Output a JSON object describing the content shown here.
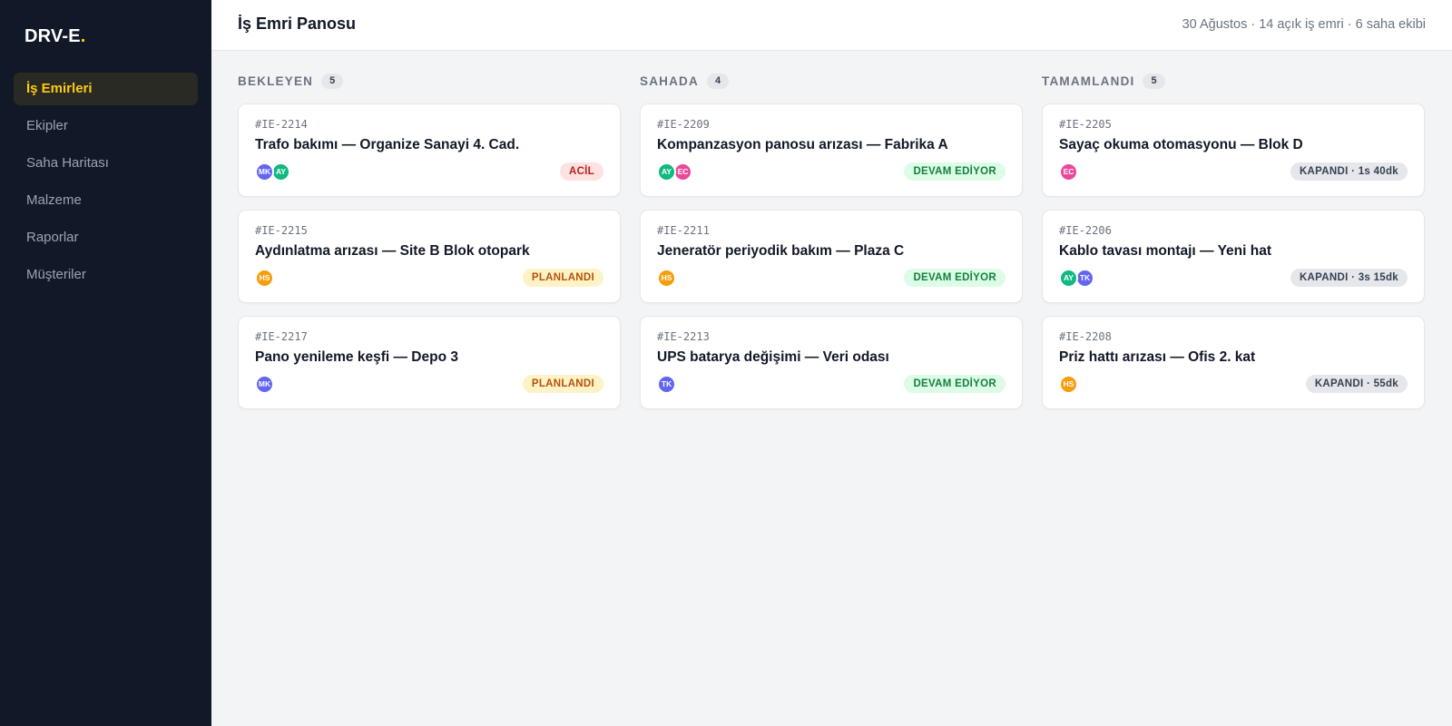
{
  "app": {
    "logo_text": "DRV-E",
    "logo_dot": "."
  },
  "sidebar": {
    "items": [
      {
        "label": "İş Emirleri",
        "active": true
      },
      {
        "label": "Ekipler",
        "active": false
      },
      {
        "label": "Saha Haritası",
        "active": false
      },
      {
        "label": "Malzeme",
        "active": false
      },
      {
        "label": "Raporlar",
        "active": false
      },
      {
        "label": "Müşteriler",
        "active": false
      }
    ]
  },
  "header": {
    "title": "İş Emri Panosu",
    "meta": "30 Ağustos · 14 açık iş emri · 6 saha ekibi"
  },
  "colors": {
    "accent": "#facc15",
    "sidebar_bg": "#111827",
    "avatar_MK": "#6366f1",
    "avatar_AY": "#10b981",
    "avatar_EC": "#ec4899",
    "avatar_HS": "#f59e0b",
    "avatar_TK": "#6366f1"
  },
  "columns": [
    {
      "title": "BEKLEYEN",
      "count": "5",
      "cards": [
        {
          "id": "#IE-2214",
          "title": "Trafo bakımı — Organize Sanayi 4. Cad.",
          "avatars": [
            "MK",
            "AY"
          ],
          "status": "ACİL",
          "status_type": "urgent"
        },
        {
          "id": "#IE-2215",
          "title": "Aydınlatma arızası — Site B Blok otopark",
          "avatars": [
            "HS"
          ],
          "status": "PLANLANDI",
          "status_type": "planned"
        },
        {
          "id": "#IE-2217",
          "title": "Pano yenileme keşfi — Depo 3",
          "avatars": [
            "MK"
          ],
          "status": "PLANLANDI",
          "status_type": "planned"
        }
      ]
    },
    {
      "title": "SAHADA",
      "count": "4",
      "cards": [
        {
          "id": "#IE-2209",
          "title": "Kompanzasyon panosu arızası — Fabrika A",
          "avatars": [
            "AY",
            "EC"
          ],
          "status": "DEVAM EDİYOR",
          "status_type": "ongoing"
        },
        {
          "id": "#IE-2211",
          "title": "Jeneratör periyodik bakım — Plaza C",
          "avatars": [
            "HS"
          ],
          "status": "DEVAM EDİYOR",
          "status_type": "ongoing"
        },
        {
          "id": "#IE-2213",
          "title": "UPS batarya değişimi — Veri odası",
          "avatars": [
            "TK"
          ],
          "status": "DEVAM EDİYOR",
          "status_type": "ongoing"
        }
      ]
    },
    {
      "title": "TAMAMLANDI",
      "count": "5",
      "cards": [
        {
          "id": "#IE-2205",
          "title": "Sayaç okuma otomasyonu — Blok D",
          "avatars": [
            "EC"
          ],
          "status": "KAPANDI · 1s 40dk",
          "status_type": "closed"
        },
        {
          "id": "#IE-2206",
          "title": "Kablo tavası montajı — Yeni hat",
          "avatars": [
            "AY",
            "TK"
          ],
          "status": "KAPANDI · 3s 15dk",
          "status_type": "closed"
        },
        {
          "id": "#IE-2208",
          "title": "Priz hattı arızası — Ofis 2. kat",
          "avatars": [
            "HS"
          ],
          "status": "KAPANDI · 55dk",
          "status_type": "closed"
        }
      ]
    }
  ]
}
